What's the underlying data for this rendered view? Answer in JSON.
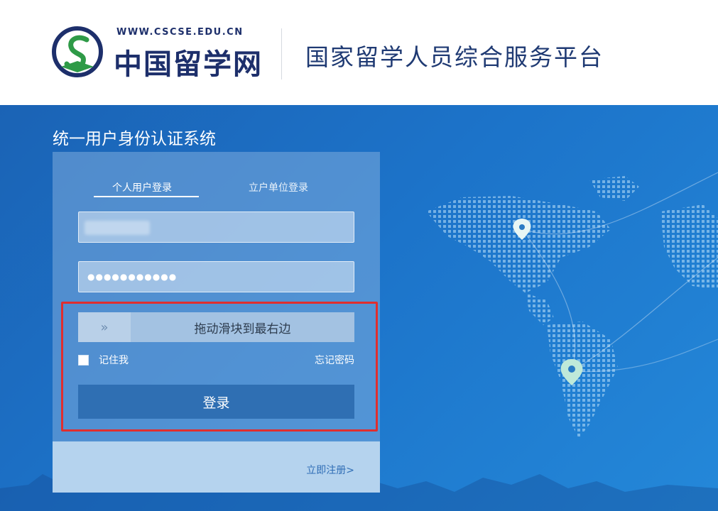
{
  "header": {
    "logo_url_text": "WWW.CSCSE.EDU.CN",
    "logo_cn_text": "中国留学网",
    "platform_title": "国家留学人员综合服务平台"
  },
  "banner": {
    "system_title": "统一用户身份认证系统"
  },
  "login": {
    "tabs": [
      {
        "label": "个人用户登录",
        "active": true
      },
      {
        "label": "立户单位登录",
        "active": false
      }
    ],
    "username_value": "",
    "password_value": "●●●●●●●●●●●",
    "slider": {
      "handle_icon": "»",
      "text": "拖动滑块到最右边"
    },
    "remember_label": "记住我",
    "forgot_label": "忘记密码",
    "login_button": "登录",
    "register_link": "立即注册>"
  },
  "colors": {
    "banner": "#1c73c9",
    "login_button": "#2f6fb3",
    "highlight": "#e02e2e",
    "brand_text": "#1f3a73"
  }
}
